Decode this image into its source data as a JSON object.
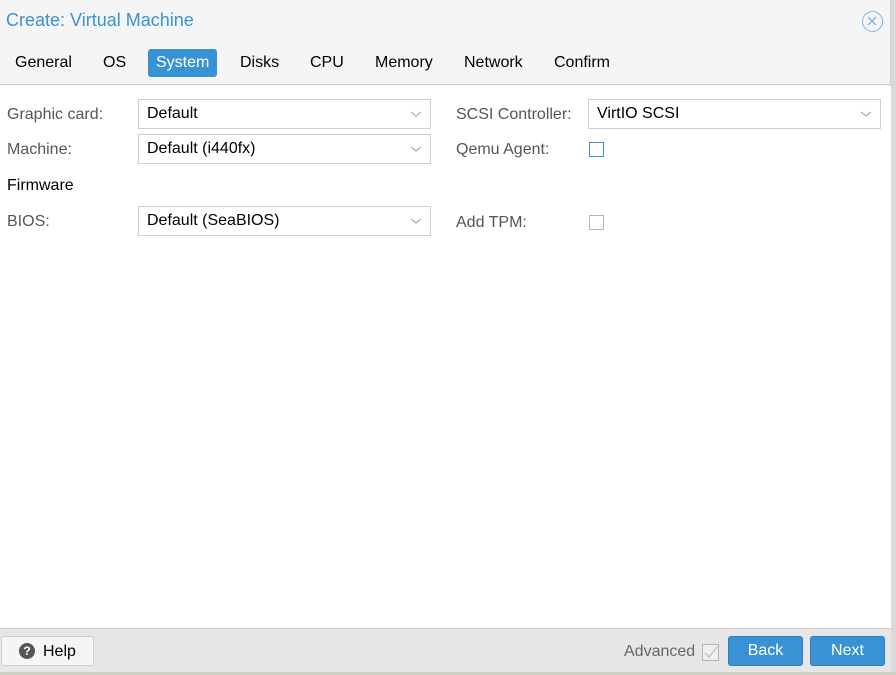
{
  "dialog": {
    "title": "Create: Virtual Machine",
    "close_icon": "close-circle-icon"
  },
  "tabs": [
    {
      "label": "General",
      "active": false
    },
    {
      "label": "OS",
      "active": false
    },
    {
      "label": "System",
      "active": true
    },
    {
      "label": "Disks",
      "active": false
    },
    {
      "label": "CPU",
      "active": false
    },
    {
      "label": "Memory",
      "active": false
    },
    {
      "label": "Network",
      "active": false
    },
    {
      "label": "Confirm",
      "active": false
    }
  ],
  "form": {
    "graphic_card": {
      "label": "Graphic card:",
      "value": "Default"
    },
    "machine": {
      "label": "Machine:",
      "value": "Default (i440fx)"
    },
    "firmware_heading": "Firmware",
    "bios": {
      "label": "BIOS:",
      "value": "Default (SeaBIOS)"
    },
    "scsi_controller": {
      "label": "SCSI Controller:",
      "value": "VirtIO SCSI"
    },
    "qemu_agent": {
      "label": "Qemu Agent:",
      "checked": false
    },
    "add_tpm": {
      "label": "Add TPM:",
      "checked": false
    }
  },
  "footer": {
    "help_label": "Help",
    "help_icon": "question-circle-icon",
    "advanced_label": "Advanced",
    "advanced_checked": true,
    "back_label": "Back",
    "next_label": "Next"
  },
  "colors": {
    "accent": "#3892d4",
    "header_bg": "#f5f5f5",
    "footer_bg": "#e6e6e6"
  }
}
